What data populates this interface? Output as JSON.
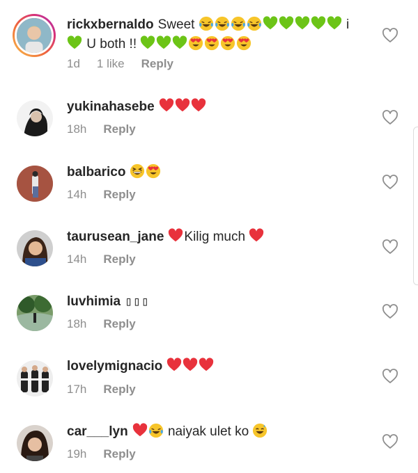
{
  "comments": [
    {
      "username": "rickxbernaldo",
      "text_a": "Sweet",
      "text_b": "i",
      "text_c": "U both !!",
      "time": "1d",
      "likes": "1 like",
      "reply": "Reply"
    },
    {
      "username": "yukinahasebe",
      "time": "18h",
      "reply": "Reply"
    },
    {
      "username": "balbarico",
      "time": "14h",
      "reply": "Reply"
    },
    {
      "username": "taurusean_jane",
      "text_a": "Kilig much",
      "time": "14h",
      "reply": "Reply"
    },
    {
      "username": "luvhimia",
      "text_a": "▯▯▯",
      "time": "18h",
      "reply": "Reply"
    },
    {
      "username": "lovelymignacio",
      "time": "17h",
      "reply": "Reply"
    },
    {
      "username": "car___lyn",
      "text_a": "naiyak ulet ko",
      "time": "19h",
      "reply": "Reply"
    }
  ],
  "icons": {
    "like": "heart-outline-icon",
    "emojis": [
      "crying-laughing-emoji",
      "green-heart-emoji",
      "heart-eyes-emoji",
      "red-heart-emoji",
      "grinning-squint-emoji",
      "sweat-smile-emoji"
    ]
  },
  "colors": {
    "text": "#262626",
    "secondary": "#8e8e8e",
    "red_heart": "#e8323c",
    "green_heart": "#6cc417",
    "emoji_yellow": "#f7c52a"
  }
}
